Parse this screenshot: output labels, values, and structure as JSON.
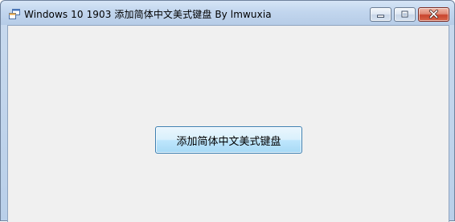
{
  "window": {
    "title": "Windows 10 1903 添加简体中文美式键盘 By lmwuxia",
    "icon": "app-window-icon",
    "controls": {
      "minimize_icon": "minimize-icon",
      "maximize_icon": "maximize-icon",
      "close_icon": "close-icon"
    }
  },
  "main": {
    "button_label": "添加简体中文美式键盘"
  },
  "colors": {
    "titlebar": "#c2d6ee",
    "client_bg": "#f0f0f0",
    "close_button": "#c9452e",
    "button_border": "#3c7fb1"
  }
}
